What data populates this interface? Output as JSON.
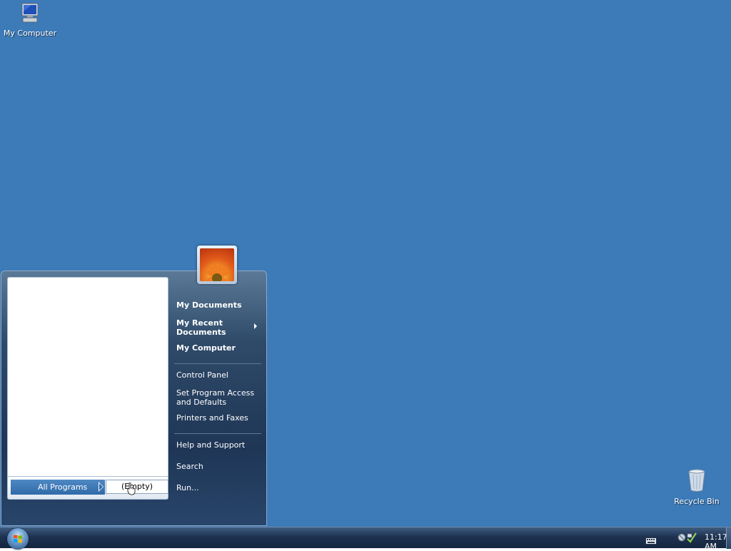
{
  "desktop": {
    "background_color": "#3c7ab8",
    "icons": [
      {
        "label": "My Computer",
        "icon": "computer-icon"
      },
      {
        "label": "Recycle Bin",
        "icon": "recycle-bin-icon"
      }
    ]
  },
  "start_menu": {
    "user_picture": "flower-picture",
    "all_programs_label": "All Programs",
    "empty_submenu_label": "(Empty)",
    "right_items": [
      {
        "label": "My Documents",
        "bold": true
      },
      {
        "label": "My Recent Documents",
        "bold": true,
        "has_submenu": true
      },
      {
        "label": "My Computer",
        "bold": true
      },
      {
        "label": "Control Panel",
        "bold": false
      },
      {
        "label": "Set Program Access and Defaults",
        "bold": false
      },
      {
        "label": "Printers and Faxes",
        "bold": false
      },
      {
        "label": "Help and Support",
        "bold": false
      },
      {
        "label": "Search",
        "bold": false
      },
      {
        "label": "Run...",
        "bold": false
      }
    ]
  },
  "taskbar": {
    "start_icon": "windows-flag-icon",
    "tray_icons": [
      "keyboard-icon",
      "network-icon"
    ],
    "clock": "11:17 AM"
  }
}
